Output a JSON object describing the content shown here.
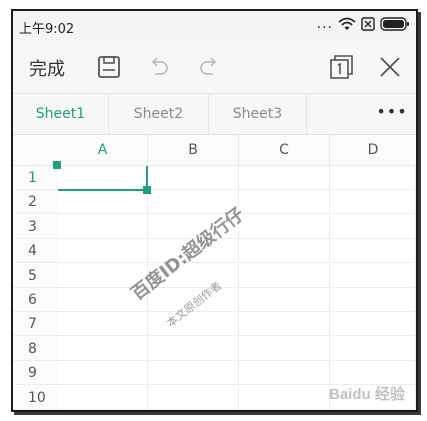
{
  "status": {
    "time": "上午9:02",
    "dots": "..."
  },
  "toolbar": {
    "done_label": "完成"
  },
  "tabs": [
    {
      "label": "Sheet1",
      "active": true
    },
    {
      "label": "Sheet2",
      "active": false
    },
    {
      "label": "Sheet3",
      "active": false
    }
  ],
  "tab_more": "•••",
  "columns": [
    "A",
    "B",
    "C",
    "D"
  ],
  "rows": [
    "1",
    "2",
    "3",
    "4",
    "5",
    "6",
    "7",
    "8",
    "9",
    "10"
  ],
  "watermark": {
    "line1": "百度ID:超级行仔",
    "line2": "本文原创作者"
  },
  "logo_text": "Baidu 经验",
  "colors": {
    "accent": "#1ba17f"
  },
  "icons": [
    "save-icon",
    "undo-icon",
    "redo-icon",
    "sheet-count-icon",
    "close-icon",
    "wifi-icon",
    "sim-icon",
    "battery-icon"
  ]
}
